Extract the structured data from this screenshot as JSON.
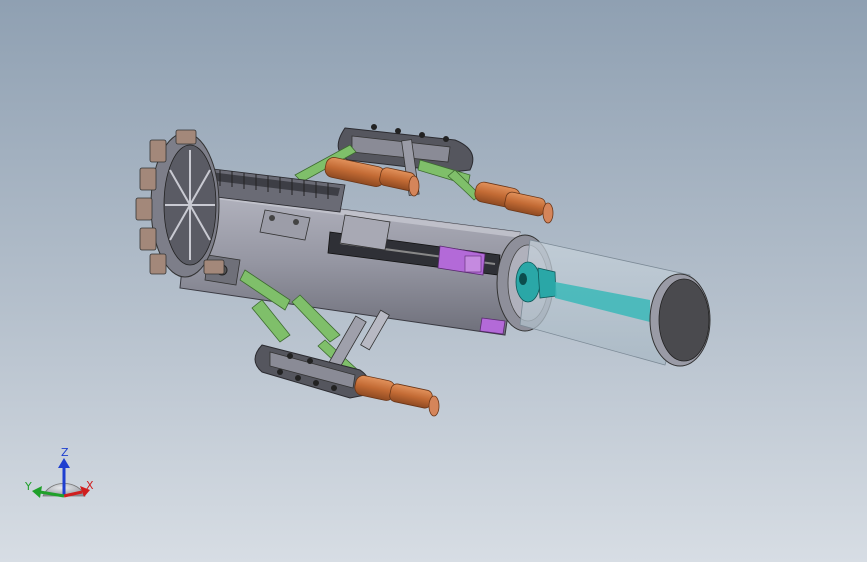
{
  "triad": {
    "z_label": "Z",
    "y_label": "Y",
    "x_label": "X",
    "z_color": "#1e3fd0",
    "y_color": "#1fa02a",
    "x_color": "#d01e1e"
  },
  "colors": {
    "steel_light": "#a9aab5",
    "steel_mid": "#8c8d99",
    "steel_dark": "#5e5f69",
    "green_link": "#7fbf6a",
    "copper": "#c9703a",
    "magenta": "#b36ad8",
    "teal": "#2aa7a7",
    "glass": "#b8c6d0",
    "end_cap": "#4a4a4e"
  }
}
